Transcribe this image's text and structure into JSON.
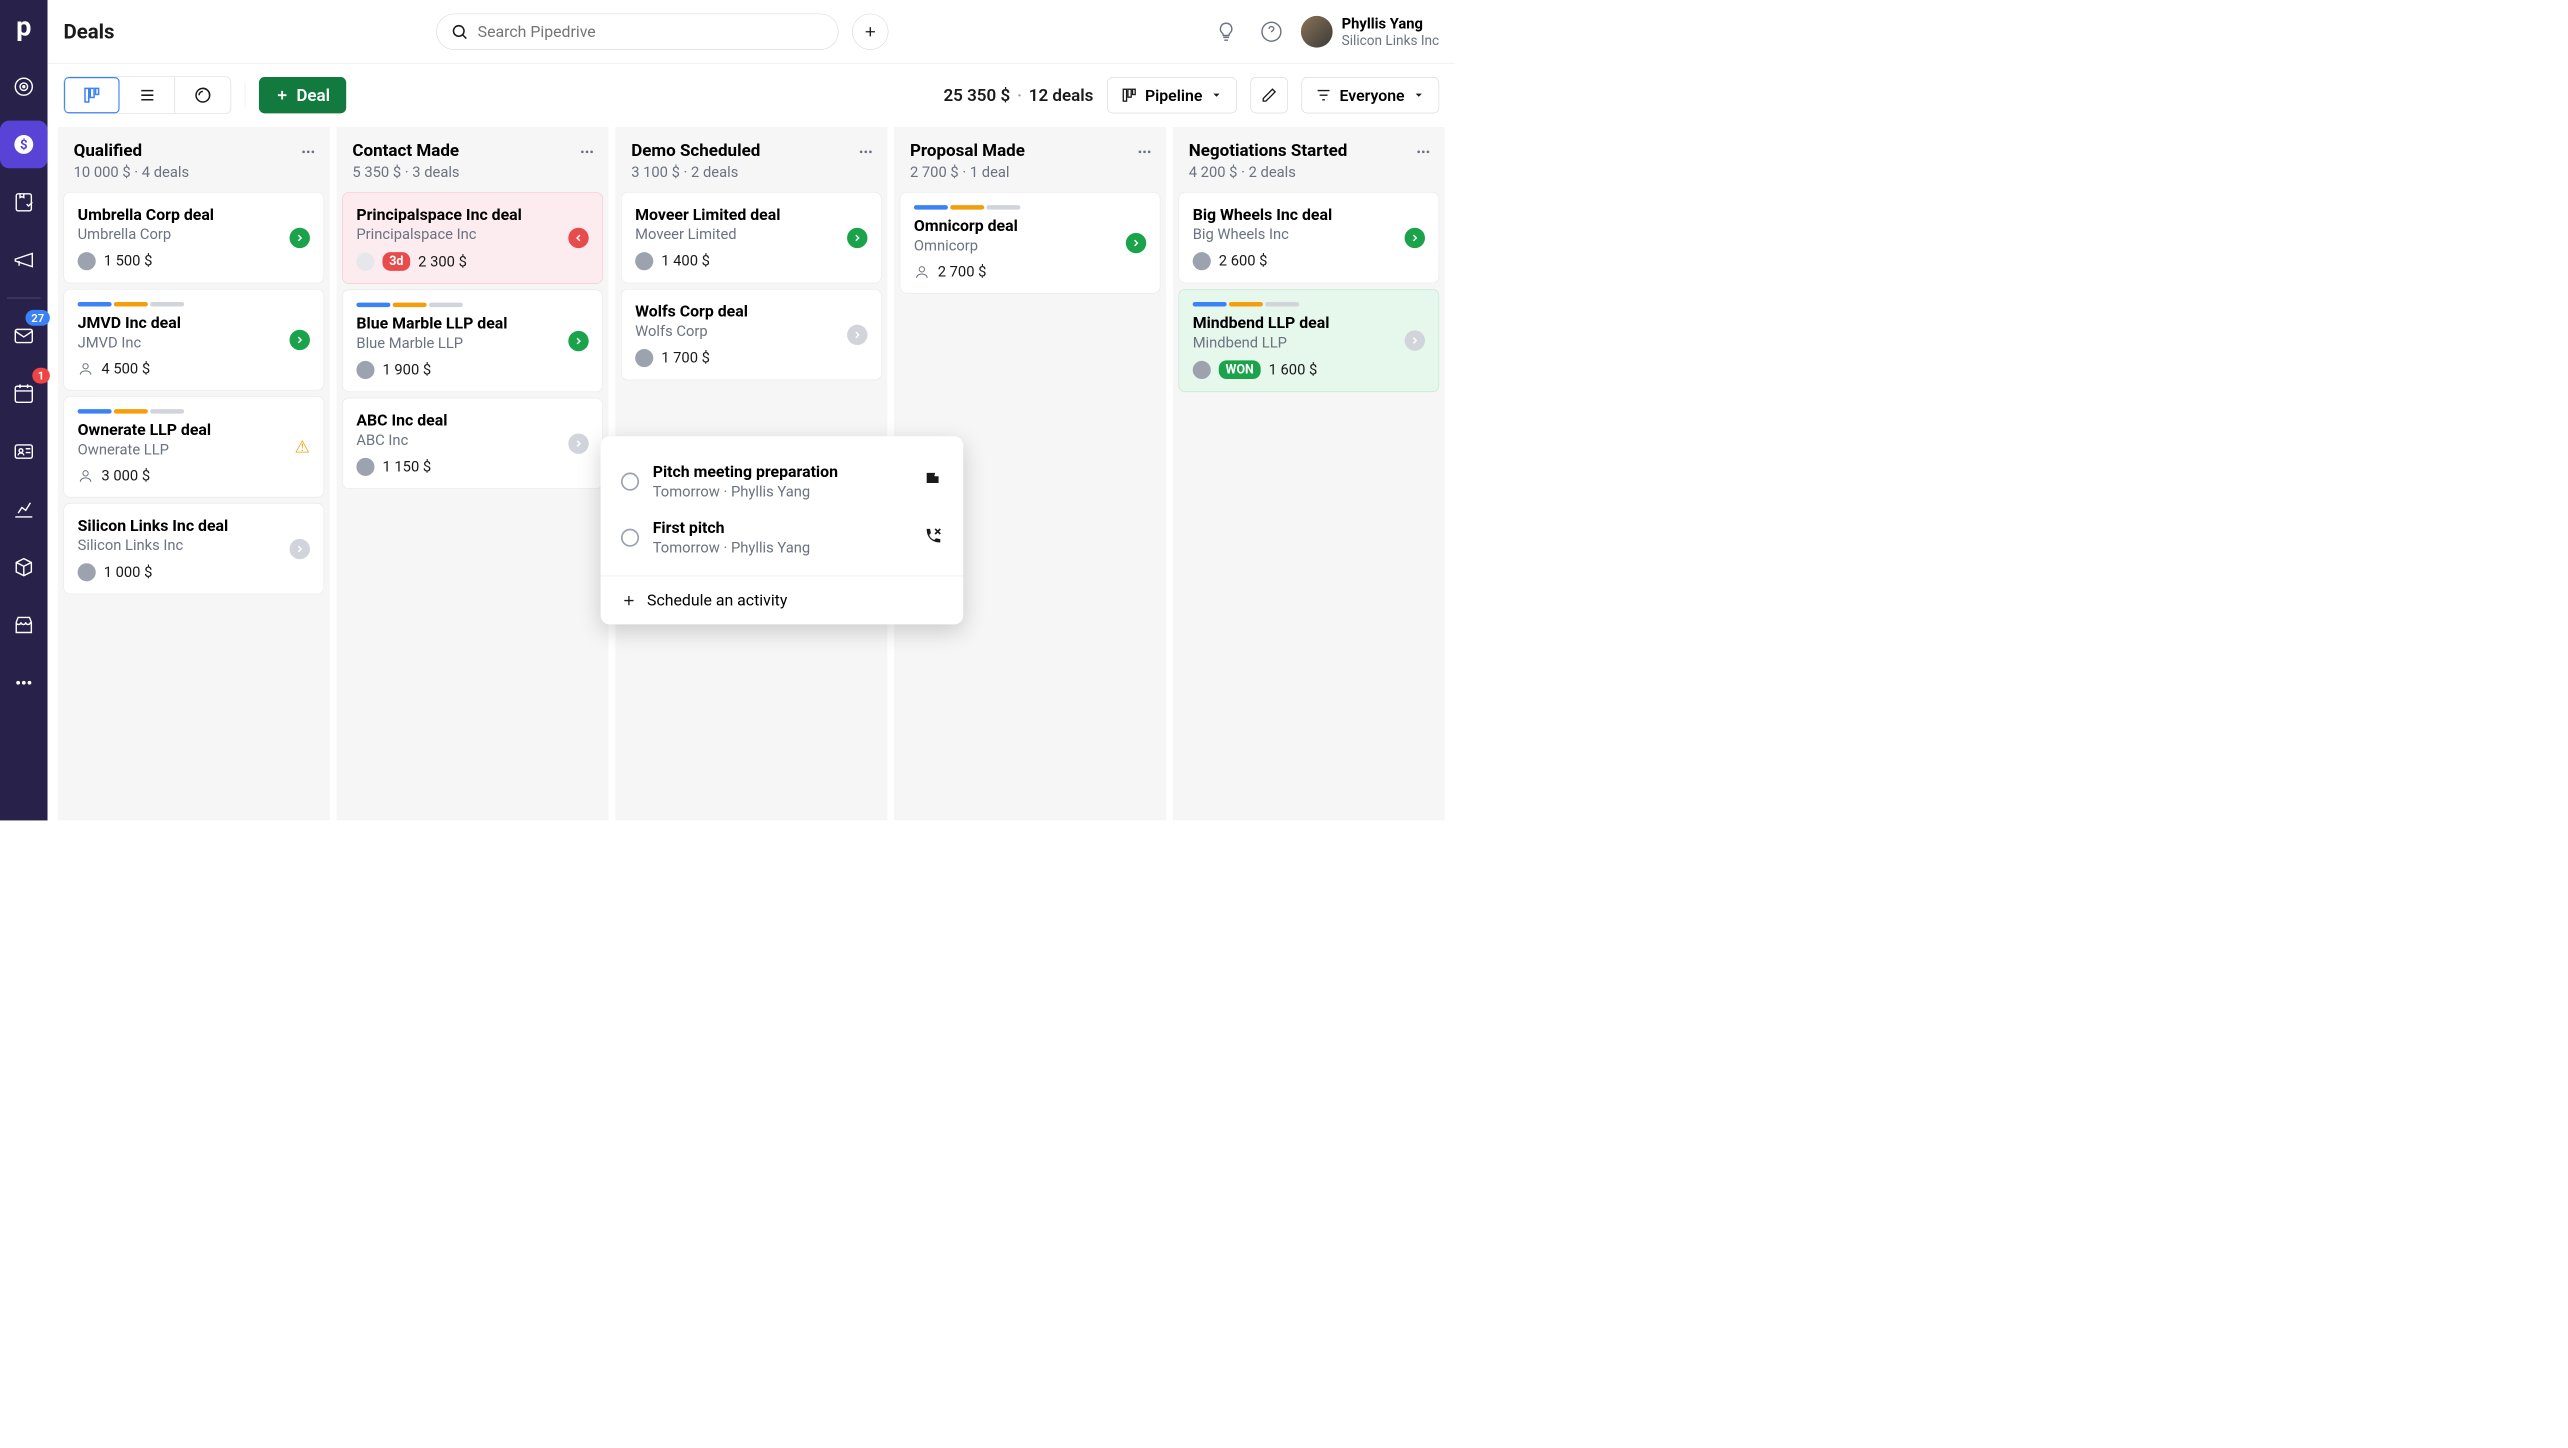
{
  "header": {
    "title": "Deals",
    "search_placeholder": "Search Pipedrive",
    "user_name": "Phyllis Yang",
    "user_org": "Silicon Links Inc"
  },
  "toolbar": {
    "add_deal_label": "Deal",
    "total_amount": "25 350 $",
    "total_deals": "12 deals",
    "pipeline_label": "Pipeline",
    "filter_label": "Everyone"
  },
  "nav_badges": {
    "mail": "27",
    "calendar": "1"
  },
  "stages": [
    {
      "title": "Qualified",
      "sub": "10 000 $ · 4 deals",
      "cards": [
        {
          "title": "Umbrella Corp deal",
          "sub": "Umbrella Corp",
          "amount": "1 500 $",
          "action": "green",
          "avatar": true
        },
        {
          "title": "JMVD Inc deal",
          "sub": "JMVD Inc",
          "amount": "4 500 $",
          "action": "green",
          "progress": true,
          "person_icon": true
        },
        {
          "title": "Ownerate LLP deal",
          "sub": "Ownerate LLP",
          "amount": "3 000 $",
          "warn": true,
          "progress": true,
          "person_icon": true
        },
        {
          "title": "Silicon Links Inc deal",
          "sub": "Silicon Links Inc",
          "amount": "1 000 $",
          "action": "gray",
          "avatar": true
        }
      ]
    },
    {
      "title": "Contact Made",
      "sub": "5 350 $ · 3 deals",
      "cards": [
        {
          "title": "Principalspace Inc deal",
          "sub": "Principalspace Inc",
          "amount": "2 300 $",
          "action": "red",
          "overdue": true,
          "chip": "3d",
          "empty_avatar": true
        },
        {
          "title": "Blue Marble LLP deal",
          "sub": "Blue Marble LLP",
          "amount": "1 900 $",
          "action": "green",
          "progress": true,
          "avatar": true
        },
        {
          "title": "ABC Inc deal",
          "sub": "ABC Inc",
          "amount": "1 150 $",
          "action": "gray",
          "avatar": true
        }
      ]
    },
    {
      "title": "Demo Scheduled",
      "sub": "3 100 $ · 2 deals",
      "cards": [
        {
          "title": "Moveer Limited deal",
          "sub": "Moveer Limited",
          "amount": "1 400 $",
          "action": "green",
          "avatar": true
        },
        {
          "title": "Wolfs Corp deal",
          "sub": "Wolfs Corp",
          "amount": "1 700 $",
          "action": "gray",
          "avatar": true
        }
      ]
    },
    {
      "title": "Proposal Made",
      "sub": "2 700 $ · 1 deal",
      "cards": [
        {
          "title": "Omnicorp deal",
          "sub": "Omnicorp",
          "amount": "2 700 $",
          "action": "green",
          "progress": true,
          "person_icon": true
        }
      ]
    },
    {
      "title": "Negotiations Started",
      "sub": "4 200 $ · 2 deals",
      "cards": [
        {
          "title": "Big Wheels Inc deal",
          "sub": "Big Wheels Inc",
          "amount": "2 600 $",
          "action": "green",
          "avatar": true
        },
        {
          "title": "Mindbend LLP deal",
          "sub": "Mindbend LLP",
          "amount": "1 600 $",
          "action": "gray",
          "progress": true,
          "won": true,
          "won_label": "WON",
          "avatar": true
        }
      ]
    }
  ],
  "popover": {
    "activities": [
      {
        "title": "Pitch meeting preparation",
        "sub": "Tomorrow · Phyllis Yang",
        "icon": "flag"
      },
      {
        "title": "First pitch",
        "sub": "Tomorrow · Phyllis Yang",
        "icon": "phone"
      }
    ],
    "schedule_label": "Schedule an activity"
  }
}
